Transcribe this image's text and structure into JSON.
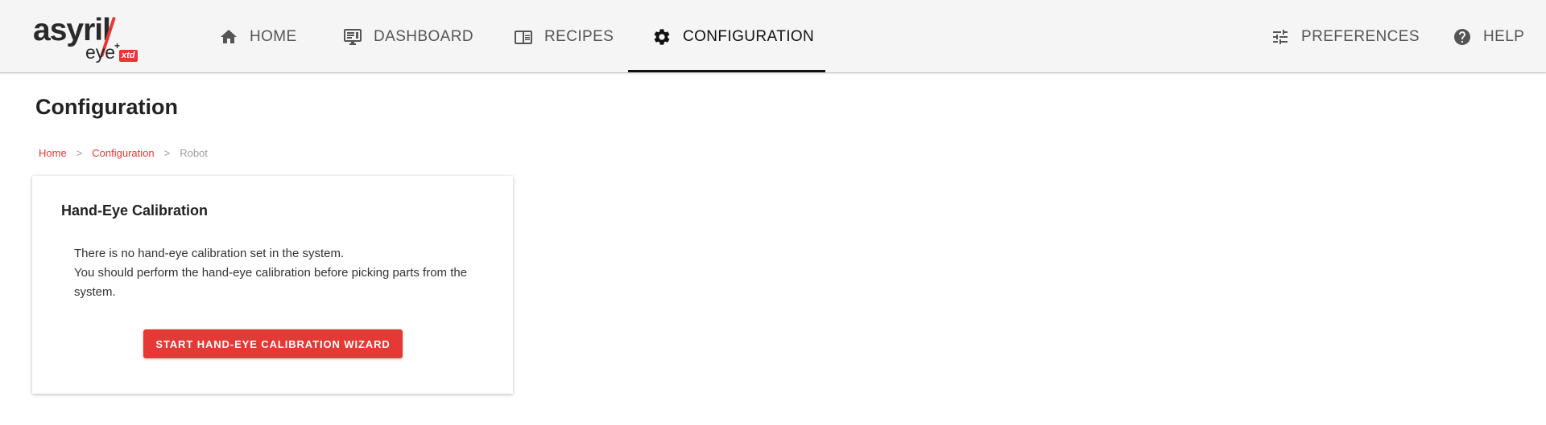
{
  "logo": {
    "word": "asyril",
    "sub": "eye",
    "plus": "+",
    "badge": "xtd"
  },
  "nav": {
    "home": "HOME",
    "dashboard": "DASHBOARD",
    "recipes": "RECIPES",
    "configuration": "CONFIGURATION",
    "preferences": "PREFERENCES",
    "help": "HELP"
  },
  "page": {
    "title": "Configuration"
  },
  "breadcrumb": {
    "home": "Home",
    "configuration": "Configuration",
    "current": "Robot",
    "separator": ">"
  },
  "card": {
    "title": "Hand-Eye Calibration",
    "line1": "There is no hand-eye calibration set in the system.",
    "line2": "You should perform the hand-eye calibration before picking parts from the system.",
    "button": "START HAND-EYE CALIBRATION WIZARD"
  },
  "colors": {
    "accent": "#e53935",
    "topbar": "#f5f5f5",
    "text": "#212121"
  },
  "icons": {
    "home": "home-icon",
    "dashboard": "monitor-icon",
    "recipes": "book-icon",
    "configuration": "gear-icon",
    "preferences": "sliders-icon",
    "help": "help-circle-icon"
  }
}
